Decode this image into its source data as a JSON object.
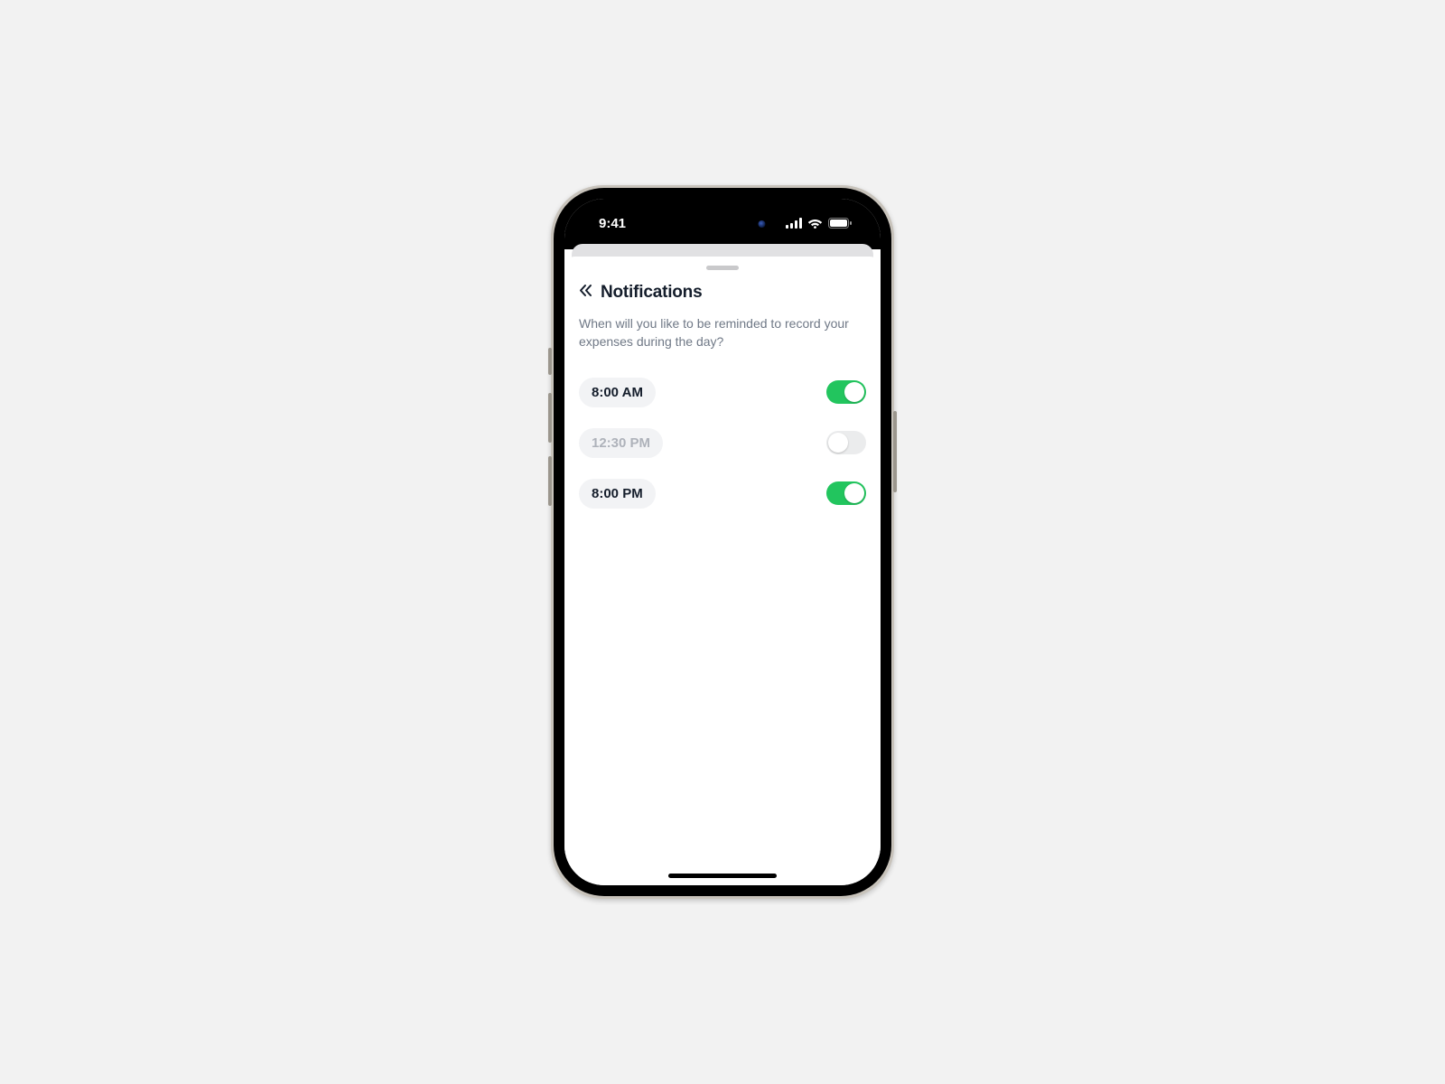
{
  "status_bar": {
    "time": "9:41"
  },
  "sheet": {
    "title": "Notifications",
    "description": "When will you like to be reminded to record your expenses during the day?",
    "rows": [
      {
        "time": "8:00 AM",
        "enabled": true
      },
      {
        "time": "12:30 PM",
        "enabled": false
      },
      {
        "time": "8:00 PM",
        "enabled": true
      }
    ]
  },
  "colors": {
    "toggle_on": "#22c55e",
    "toggle_off": "#ebeced"
  }
}
